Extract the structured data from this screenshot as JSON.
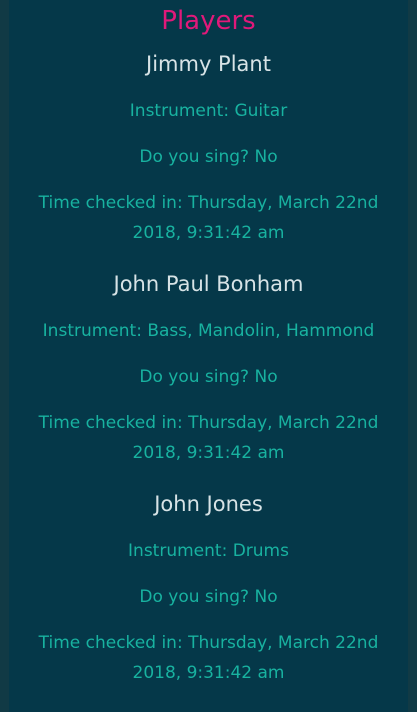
{
  "header": {
    "title": "Players"
  },
  "players": [
    {
      "name": "Jimmy Plant",
      "instrument": "Instrument: Guitar",
      "sing": "Do you sing? No",
      "time_line1": "Time checked in: Thursday, March 22nd",
      "time_line2": "2018, 9:31:42 am"
    },
    {
      "name": "John Paul Bonham",
      "instrument": "Instrument: Bass, Mandolin, Hammond",
      "sing": "Do you sing? No",
      "time_line1": "Time checked in: Thursday, March 22nd",
      "time_line2": "2018, 9:31:42 am"
    },
    {
      "name": "John Jones",
      "instrument": "Instrument: Drums",
      "sing": "Do you sing? No",
      "time_line1": "Time checked in: Thursday, March 22nd",
      "time_line2": "2018, 9:31:42 am"
    }
  ],
  "colors": {
    "title": "#e0197a",
    "name": "#d7e3e6",
    "detail": "#18b2a0",
    "panel_bg": "#053849"
  }
}
